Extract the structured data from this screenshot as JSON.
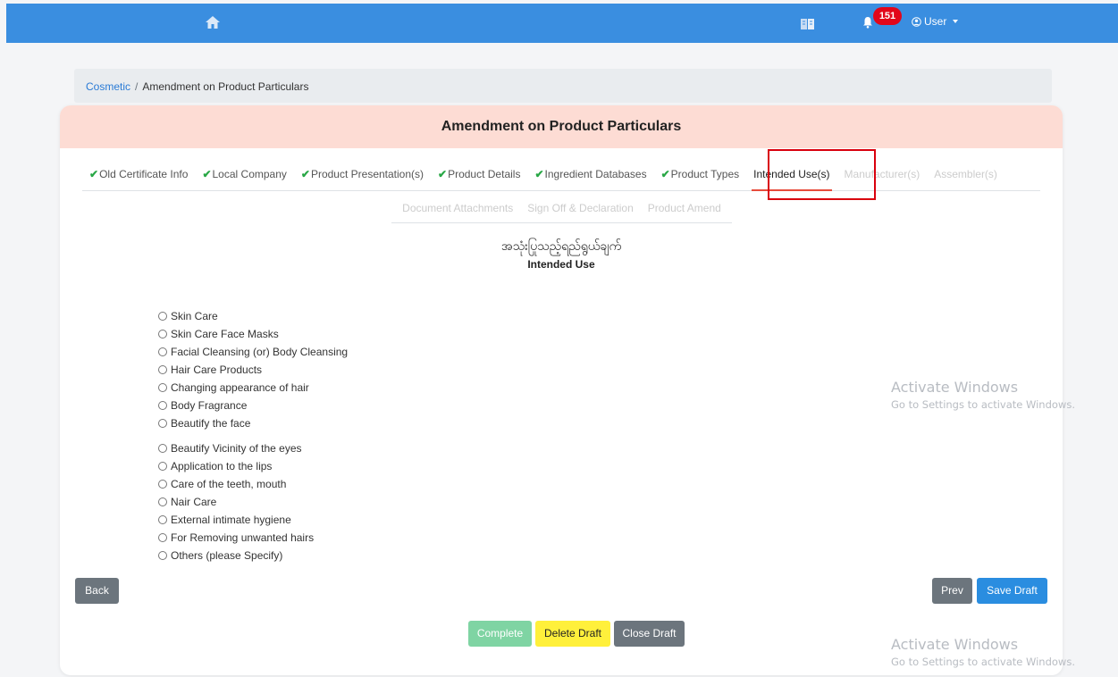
{
  "navbar": {
    "home_icon": "home-icon",
    "map_icon": "map-book-icon",
    "bell_icon": "bell-icon",
    "notification_count": "151",
    "user_label": "User"
  },
  "breadcrumb": {
    "root": "Cosmetic",
    "separator": "/",
    "current": "Amendment on Product Particulars"
  },
  "card": {
    "title": "Amendment on Product Particulars"
  },
  "tabs": {
    "check_mark": "✔",
    "row1": [
      "Old Certificate Info",
      "Local Company",
      "Product Presentation(s)",
      "Product Details",
      "Ingredient Databases",
      "Product Types",
      "Intended Use(s)",
      "Manufacturer(s)",
      "Assembler(s)"
    ],
    "row2": [
      "Document Attachments",
      "Sign Off & Declaration",
      "Product Amend"
    ]
  },
  "section": {
    "title_myanmar": "အသုံးပြုသည့်ရည်ရွယ်ချက်",
    "title_english": "Intended Use"
  },
  "intended_use_options": [
    "Skin Care",
    "Skin Care Face Masks",
    "Facial Cleansing (or) Body Cleansing",
    "Hair Care Products",
    "Changing appearance of hair",
    "Body Fragrance",
    "Beautify the face",
    "Beautify Vicinity of the eyes",
    "Application to the lips",
    "Care of the teeth, mouth",
    "Nair Care",
    "External intimate hygiene",
    "For Removing unwanted hairs",
    "Others (please Specify)"
  ],
  "buttons": {
    "back": "Back",
    "prev": "Prev",
    "save_draft": "Save Draft",
    "complete": "Complete",
    "delete_draft": "Delete Draft",
    "close_draft": "Close Draft"
  },
  "watermark": {
    "line1": "Activate Windows",
    "line2": "Go to Settings to activate Windows."
  },
  "colors": {
    "navbar": "#3a8ee0",
    "badge": "#e2061a",
    "card_header": "#fddcd4",
    "check": "#28a745",
    "highlight_box": "#d9000d",
    "save_button": "#2a8de0"
  }
}
